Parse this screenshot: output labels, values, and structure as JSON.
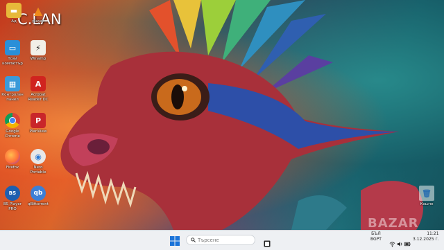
{
  "watermark": "C.LAN",
  "site_watermark": "BAZAR",
  "desktop_icons": [
    {
      "name": "folder-user",
      "label": "Ад"
    },
    {
      "name": "vlc",
      "label": "player"
    },
    {
      "name": "this-pc",
      "label": "Този компютър"
    },
    {
      "name": "winamp",
      "label": "Winamp"
    },
    {
      "name": "control-panel",
      "label": "Контролен панел"
    },
    {
      "name": "acrobat",
      "label": "Acrobat Reader DC"
    },
    {
      "name": "chrome",
      "label": "Google Chrome"
    },
    {
      "name": "planview",
      "label": "PlanView"
    },
    {
      "name": "firefox",
      "label": "Firefox"
    },
    {
      "name": "nero",
      "label": "Nero Portable"
    },
    {
      "name": "bs-player",
      "label": "BS Player PRO"
    },
    {
      "name": "qbittorrent",
      "label": "qBittorrent"
    },
    {
      "name": "recycle-bin",
      "label": "Кошче"
    }
  ],
  "taskbar": {
    "search_placeholder": "Търсене",
    "lang_top": "БЪЛ",
    "lang_bottom": "BGPT",
    "time": "11:21",
    "date": "3.12.2025 г."
  },
  "colors": {
    "taskbar": "#eef0f3",
    "start_accent": "#1a73d9"
  }
}
